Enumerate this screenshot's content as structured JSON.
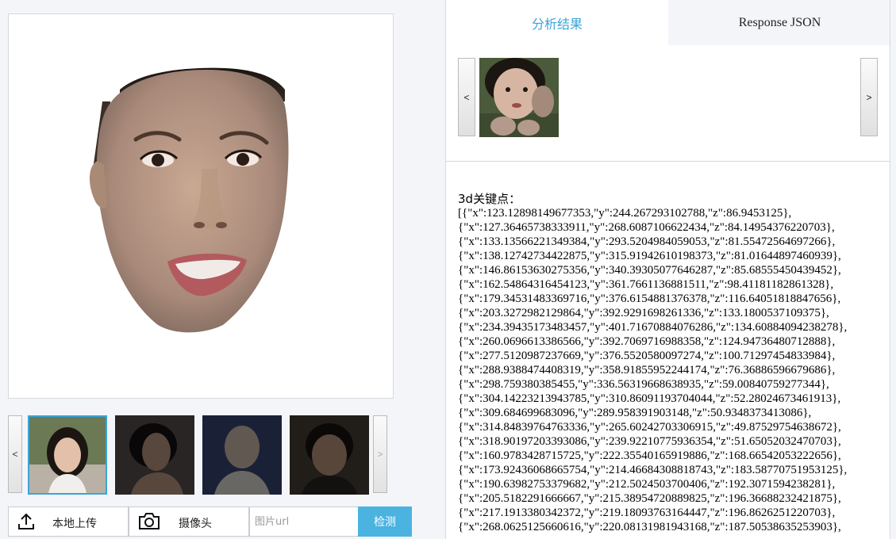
{
  "left": {
    "preview": {
      "image": "3d-face-render"
    },
    "thumbnails": {
      "prev_label": "<",
      "next_label": ">",
      "items": [
        {
          "name": "face-1",
          "active": true
        },
        {
          "name": "face-2",
          "active": false
        },
        {
          "name": "face-3",
          "active": false
        },
        {
          "name": "face-4",
          "active": false
        }
      ]
    },
    "toolbar": {
      "upload_label": "本地上传",
      "upload_icon": "upload-icon",
      "camera_label": "摄像头",
      "camera_icon": "camera-icon",
      "url_placeholder": "图片url",
      "url_value": "",
      "detect_label": "检测"
    }
  },
  "right": {
    "tabs": [
      {
        "label": "分析结果",
        "active": true
      },
      {
        "label": "Response JSON",
        "active": false
      }
    ],
    "result_nav": {
      "prev_label": "<",
      "next_label": ">"
    },
    "keypoints": {
      "title": "3d关键点：",
      "lines": [
        "[{\"x\":123.12898149677353,\"y\":244.267293102788,\"z\":86.9453125},",
        "{\"x\":127.36465738333911,\"y\":268.6087106622434,\"z\":84.14954376220703},",
        "{\"x\":133.13566221349384,\"y\":293.5204984059053,\"z\":81.55472564697266},",
        "{\"x\":138.12742734422875,\"y\":315.91942610198373,\"z\":81.01644897460939},",
        "{\"x\":146.86153630275356,\"y\":340.39305077646287,\"z\":85.68555450439452},",
        "{\"x\":162.54864316454123,\"y\":361.7661136881511,\"z\":98.41181182861328},",
        "{\"x\":179.34531483369716,\"y\":376.6154881376378,\"z\":116.64051818847656},",
        "{\"x\":203.3272982129864,\"y\":392.9291698261336,\"z\":133.1800537109375},",
        "{\"x\":234.39435173483457,\"y\":401.71670884076286,\"z\":134.60884094238278},",
        "{\"x\":260.0696613386566,\"y\":392.7069716988358,\"z\":124.94736480712888},",
        "{\"x\":277.5120987237669,\"y\":376.5520580097274,\"z\":100.71297454833984},",
        "{\"x\":288.9388474408319,\"y\":358.91855952244174,\"z\":76.36886596679686},",
        "{\"x\":298.759380385455,\"y\":336.56319668638935,\"z\":59.00840759277344},",
        "{\"x\":304.14223213943785,\"y\":310.86091193704044,\"z\":52.28024673461913},",
        "{\"x\":309.684699683096,\"y\":289.958391903148,\"z\":50.9348373413086},",
        "{\"x\":314.84839764763336,\"y\":265.60242703306915,\"z\":49.87529754638672},",
        "{\"x\":318.90197203393086,\"y\":239.92210775936354,\"z\":51.65052032470703},",
        "{\"x\":160.9783428715725,\"y\":222.35540165919886,\"z\":168.66542053222656},",
        "{\"x\":173.92436068665754,\"y\":214.46684308818743,\"z\":183.58770751953125},",
        "{\"x\":190.63982753379682,\"y\":212.5024503700406,\"z\":192.3071594238281},",
        "{\"x\":205.5182291666667,\"y\":215.38954720889825,\"z\":196.36688232421875},",
        "{\"x\":217.1913380342372,\"y\":219.18093763164447,\"z\":196.8626251220703},",
        "{\"x\":268.0625125660616,\"y\":220.08131981943168,\"z\":187.50538635253903},"
      ]
    }
  }
}
